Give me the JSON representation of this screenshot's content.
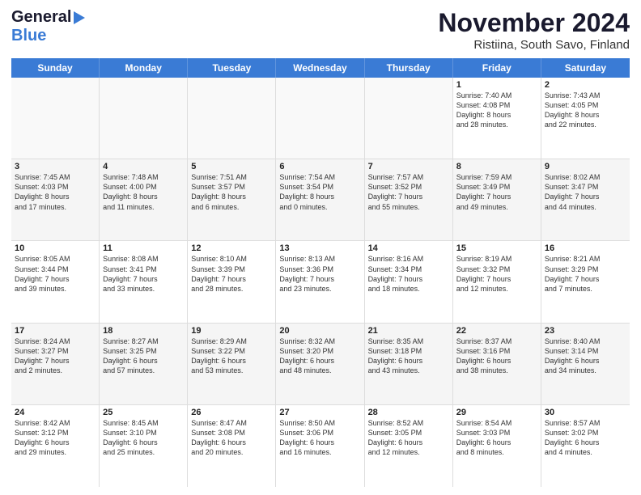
{
  "logo": {
    "line1": "General",
    "icon": "▶",
    "line2": "Blue"
  },
  "title": "November 2024",
  "location": "Ristiina, South Savo, Finland",
  "header_days": [
    "Sunday",
    "Monday",
    "Tuesday",
    "Wednesday",
    "Thursday",
    "Friday",
    "Saturday"
  ],
  "weeks": [
    {
      "alt": false,
      "cells": [
        {
          "day": "",
          "info": ""
        },
        {
          "day": "",
          "info": ""
        },
        {
          "day": "",
          "info": ""
        },
        {
          "day": "",
          "info": ""
        },
        {
          "day": "",
          "info": ""
        },
        {
          "day": "1",
          "info": "Sunrise: 7:40 AM\nSunset: 4:08 PM\nDaylight: 8 hours\nand 28 minutes."
        },
        {
          "day": "2",
          "info": "Sunrise: 7:43 AM\nSunset: 4:05 PM\nDaylight: 8 hours\nand 22 minutes."
        }
      ]
    },
    {
      "alt": true,
      "cells": [
        {
          "day": "3",
          "info": "Sunrise: 7:45 AM\nSunset: 4:03 PM\nDaylight: 8 hours\nand 17 minutes."
        },
        {
          "day": "4",
          "info": "Sunrise: 7:48 AM\nSunset: 4:00 PM\nDaylight: 8 hours\nand 11 minutes."
        },
        {
          "day": "5",
          "info": "Sunrise: 7:51 AM\nSunset: 3:57 PM\nDaylight: 8 hours\nand 6 minutes."
        },
        {
          "day": "6",
          "info": "Sunrise: 7:54 AM\nSunset: 3:54 PM\nDaylight: 8 hours\nand 0 minutes."
        },
        {
          "day": "7",
          "info": "Sunrise: 7:57 AM\nSunset: 3:52 PM\nDaylight: 7 hours\nand 55 minutes."
        },
        {
          "day": "8",
          "info": "Sunrise: 7:59 AM\nSunset: 3:49 PM\nDaylight: 7 hours\nand 49 minutes."
        },
        {
          "day": "9",
          "info": "Sunrise: 8:02 AM\nSunset: 3:47 PM\nDaylight: 7 hours\nand 44 minutes."
        }
      ]
    },
    {
      "alt": false,
      "cells": [
        {
          "day": "10",
          "info": "Sunrise: 8:05 AM\nSunset: 3:44 PM\nDaylight: 7 hours\nand 39 minutes."
        },
        {
          "day": "11",
          "info": "Sunrise: 8:08 AM\nSunset: 3:41 PM\nDaylight: 7 hours\nand 33 minutes."
        },
        {
          "day": "12",
          "info": "Sunrise: 8:10 AM\nSunset: 3:39 PM\nDaylight: 7 hours\nand 28 minutes."
        },
        {
          "day": "13",
          "info": "Sunrise: 8:13 AM\nSunset: 3:36 PM\nDaylight: 7 hours\nand 23 minutes."
        },
        {
          "day": "14",
          "info": "Sunrise: 8:16 AM\nSunset: 3:34 PM\nDaylight: 7 hours\nand 18 minutes."
        },
        {
          "day": "15",
          "info": "Sunrise: 8:19 AM\nSunset: 3:32 PM\nDaylight: 7 hours\nand 12 minutes."
        },
        {
          "day": "16",
          "info": "Sunrise: 8:21 AM\nSunset: 3:29 PM\nDaylight: 7 hours\nand 7 minutes."
        }
      ]
    },
    {
      "alt": true,
      "cells": [
        {
          "day": "17",
          "info": "Sunrise: 8:24 AM\nSunset: 3:27 PM\nDaylight: 7 hours\nand 2 minutes."
        },
        {
          "day": "18",
          "info": "Sunrise: 8:27 AM\nSunset: 3:25 PM\nDaylight: 6 hours\nand 57 minutes."
        },
        {
          "day": "19",
          "info": "Sunrise: 8:29 AM\nSunset: 3:22 PM\nDaylight: 6 hours\nand 53 minutes."
        },
        {
          "day": "20",
          "info": "Sunrise: 8:32 AM\nSunset: 3:20 PM\nDaylight: 6 hours\nand 48 minutes."
        },
        {
          "day": "21",
          "info": "Sunrise: 8:35 AM\nSunset: 3:18 PM\nDaylight: 6 hours\nand 43 minutes."
        },
        {
          "day": "22",
          "info": "Sunrise: 8:37 AM\nSunset: 3:16 PM\nDaylight: 6 hours\nand 38 minutes."
        },
        {
          "day": "23",
          "info": "Sunrise: 8:40 AM\nSunset: 3:14 PM\nDaylight: 6 hours\nand 34 minutes."
        }
      ]
    },
    {
      "alt": false,
      "cells": [
        {
          "day": "24",
          "info": "Sunrise: 8:42 AM\nSunset: 3:12 PM\nDaylight: 6 hours\nand 29 minutes."
        },
        {
          "day": "25",
          "info": "Sunrise: 8:45 AM\nSunset: 3:10 PM\nDaylight: 6 hours\nand 25 minutes."
        },
        {
          "day": "26",
          "info": "Sunrise: 8:47 AM\nSunset: 3:08 PM\nDaylight: 6 hours\nand 20 minutes."
        },
        {
          "day": "27",
          "info": "Sunrise: 8:50 AM\nSunset: 3:06 PM\nDaylight: 6 hours\nand 16 minutes."
        },
        {
          "day": "28",
          "info": "Sunrise: 8:52 AM\nSunset: 3:05 PM\nDaylight: 6 hours\nand 12 minutes."
        },
        {
          "day": "29",
          "info": "Sunrise: 8:54 AM\nSunset: 3:03 PM\nDaylight: 6 hours\nand 8 minutes."
        },
        {
          "day": "30",
          "info": "Sunrise: 8:57 AM\nSunset: 3:02 PM\nDaylight: 6 hours\nand 4 minutes."
        }
      ]
    }
  ]
}
